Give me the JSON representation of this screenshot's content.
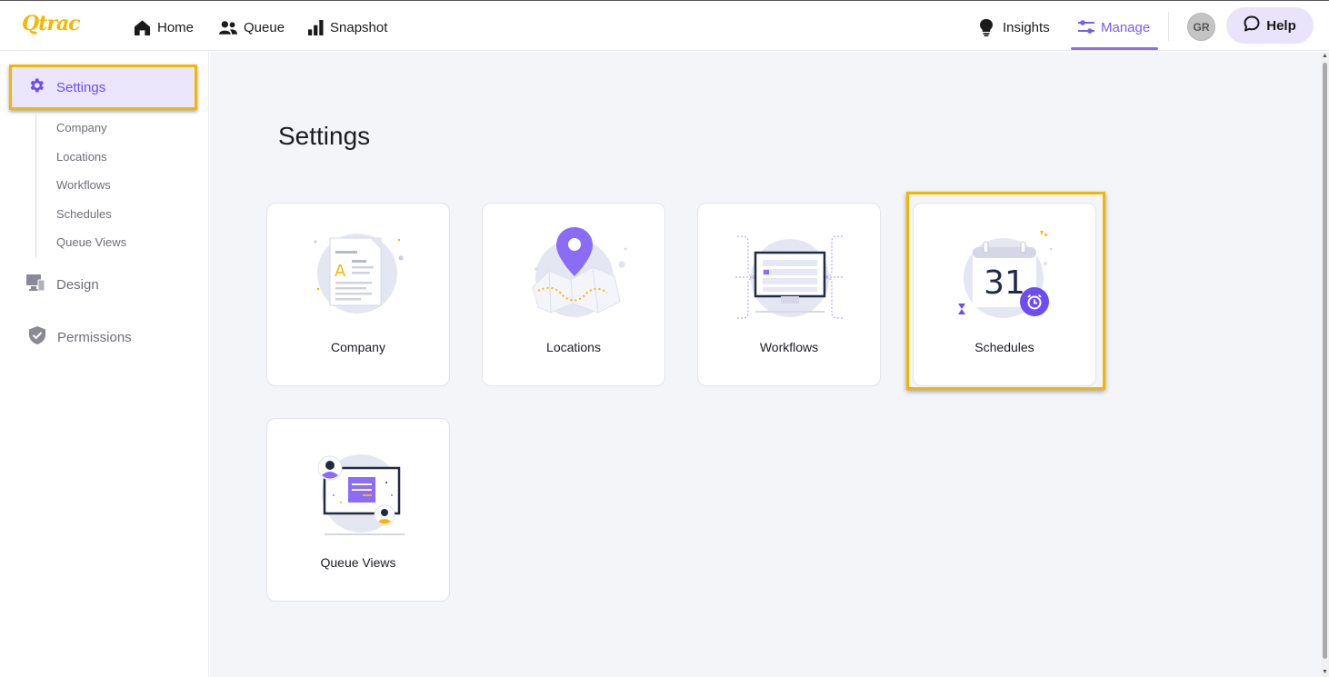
{
  "app": {
    "logo_text": "Qtrac",
    "brand_color": "#f5b800",
    "accent_color": "#7b5cf5",
    "highlight_color": "#f2b705"
  },
  "topnav": {
    "home": {
      "label": "Home",
      "icon": "home-icon"
    },
    "queue": {
      "label": "Queue",
      "icon": "people-icon"
    },
    "snapshot": {
      "label": "Snapshot",
      "icon": "bar-chart-icon"
    },
    "insights": {
      "label": "Insights",
      "icon": "lightbulb-icon"
    },
    "manage": {
      "label": "Manage",
      "icon": "sliders-icon",
      "active": true
    },
    "avatar_initials": "GR",
    "help": {
      "label": "Help",
      "icon": "chat-bubble-icon"
    }
  },
  "sidebar": {
    "settings": {
      "label": "Settings",
      "icon": "gear-icon",
      "active": true
    },
    "sub_items": [
      {
        "label": "Company"
      },
      {
        "label": "Locations"
      },
      {
        "label": "Workflows"
      },
      {
        "label": "Schedules"
      },
      {
        "label": "Queue Views"
      }
    ],
    "design": {
      "label": "Design",
      "icon": "monitor-icon"
    },
    "permissions": {
      "label": "Permissions",
      "icon": "shield-check-icon"
    }
  },
  "main": {
    "title": "Settings",
    "cards": [
      {
        "label": "Company",
        "icon": "company-document-illustration"
      },
      {
        "label": "Locations",
        "icon": "map-pin-illustration"
      },
      {
        "label": "Workflows",
        "icon": "workflow-monitor-illustration"
      },
      {
        "label": "Schedules",
        "icon": "calendar-illustration",
        "calendar_day": "31",
        "highlighted": true
      },
      {
        "label": "Queue Views",
        "icon": "queue-views-illustration"
      }
    ]
  }
}
